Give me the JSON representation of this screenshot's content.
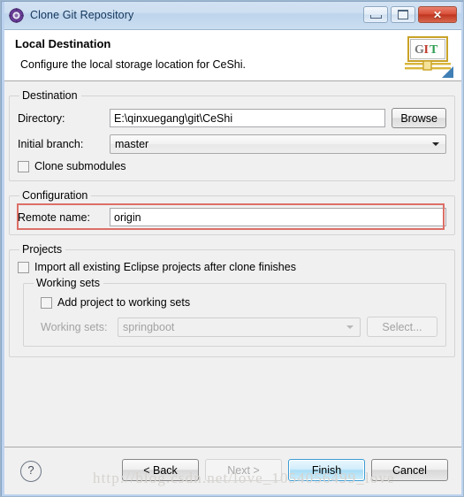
{
  "window": {
    "title": "Clone Git Repository",
    "icon": "git-repository-icon",
    "controls": {
      "minimize": "minimize-button",
      "maximize": "maximize-button",
      "close": "close-button"
    }
  },
  "header": {
    "title": "Local Destination",
    "description": "Configure the local storage location for CeShi.",
    "logo_text": "GIT",
    "logo_colors": {
      "g": "#7a7a7a",
      "i": "#c0392b",
      "t": "#2f9e52"
    }
  },
  "destination": {
    "legend": "Destination",
    "directory": {
      "label": "Directory:",
      "value": "E:\\qinxuegang\\git\\CeShi",
      "placeholder": ""
    },
    "browse_button": "Browse",
    "initial_branch": {
      "label": "Initial branch:",
      "value": "master"
    },
    "clone_submodules": {
      "label": "Clone submodules",
      "checked": false
    },
    "highlight_color": "#dc6f67"
  },
  "configuration": {
    "legend": "Configuration",
    "remote_name": {
      "label": "Remote name:",
      "value": "origin",
      "placeholder": ""
    }
  },
  "projects": {
    "legend": "Projects",
    "import_all": {
      "label": "Import all existing Eclipse projects after clone finishes",
      "checked": false
    },
    "working_sets_group": {
      "legend": "Working sets",
      "add_project": {
        "label": "Add project to working sets",
        "checked": false
      },
      "working_sets": {
        "label": "Working sets:",
        "value": "springboot",
        "enabled": false
      },
      "select_button": "Select..."
    }
  },
  "footer": {
    "help_icon": "?",
    "buttons": {
      "back": "< Back",
      "next": "Next >",
      "finish": "Finish",
      "cancel": "Cancel"
    }
  },
  "watermark": "http://blog.csdn.net/love_1054056499_love"
}
